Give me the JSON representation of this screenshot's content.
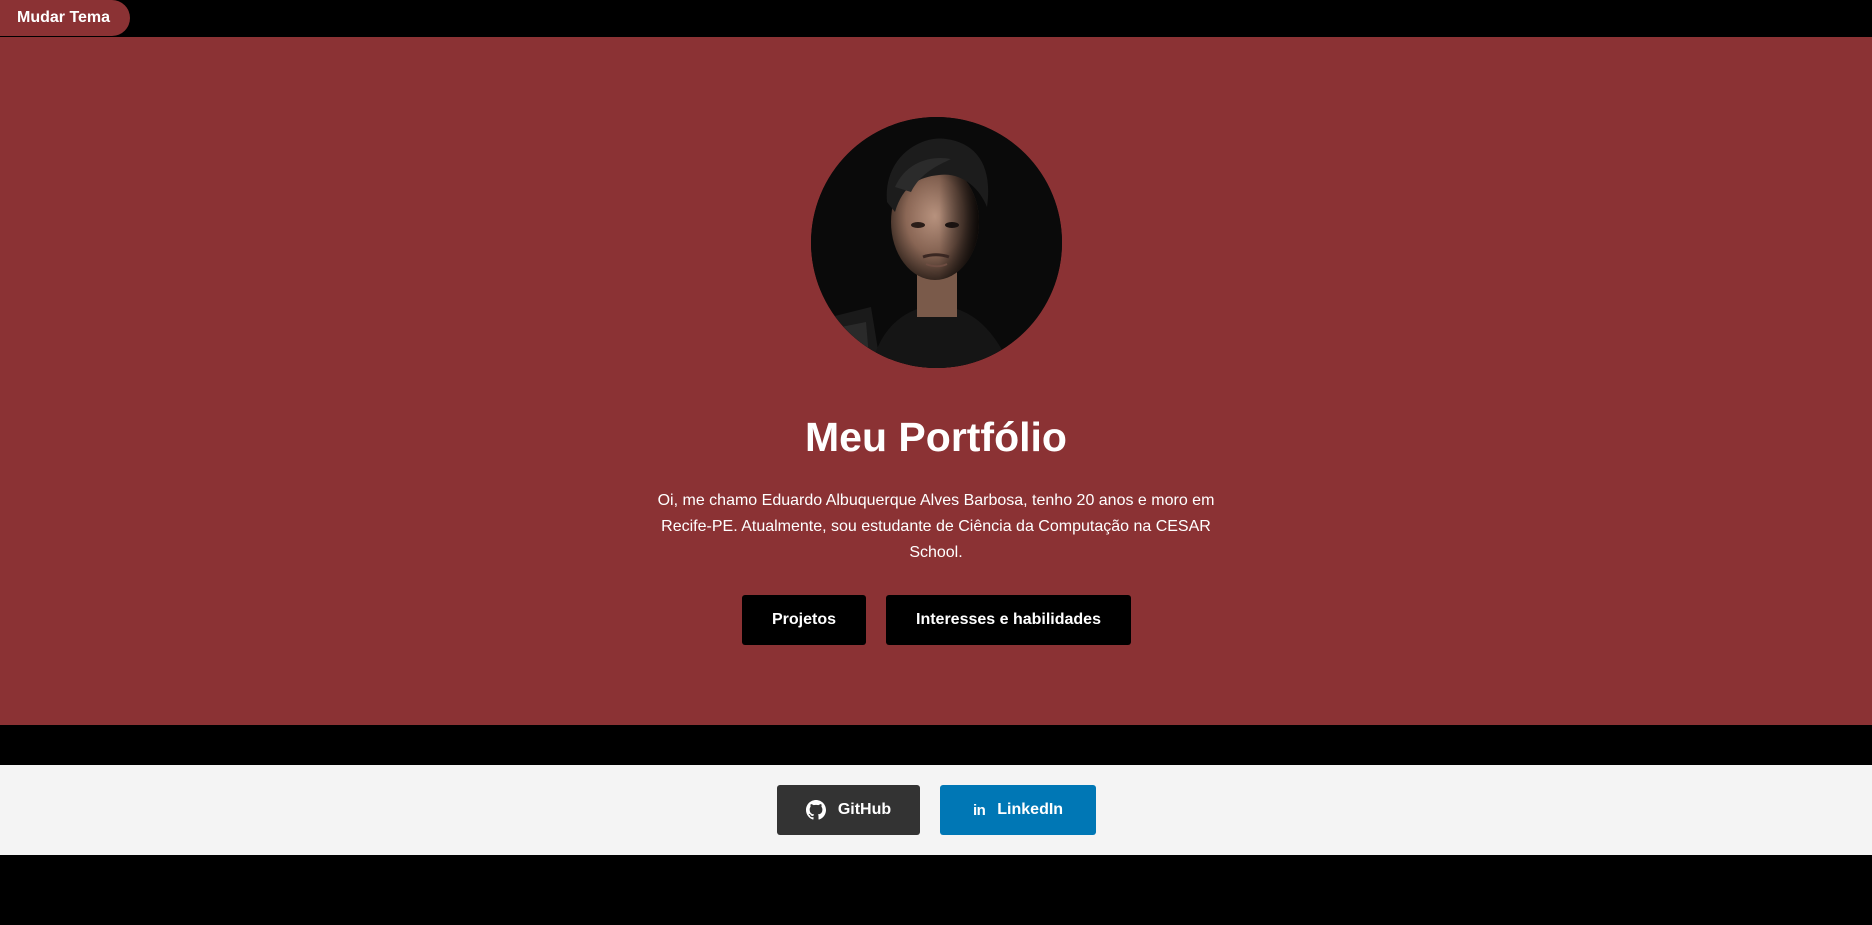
{
  "theme_toggle": {
    "label": "Mudar Tema"
  },
  "hero": {
    "avatar_alt": "profile-photo",
    "title": "Meu Portfólio",
    "intro": "Oi, me chamo Eduardo Albuquerque Alves Barbosa, tenho 20 anos e moro em Recife-PE. Atualmente, sou estudante de Ciência da Computação na CESAR School.",
    "buttons": [
      {
        "label": "Projetos"
      },
      {
        "label": "Interesses e habilidades"
      }
    ]
  },
  "footer": {
    "links": [
      {
        "label": "GitHub",
        "icon": "github-icon"
      },
      {
        "label": "LinkedIn",
        "icon": "linkedin-icon"
      }
    ]
  },
  "colors": {
    "accent": "#8b3234",
    "background": "#000000",
    "footer_bg": "#f4f4f4",
    "github": "#333333",
    "linkedin": "#0077b5"
  }
}
